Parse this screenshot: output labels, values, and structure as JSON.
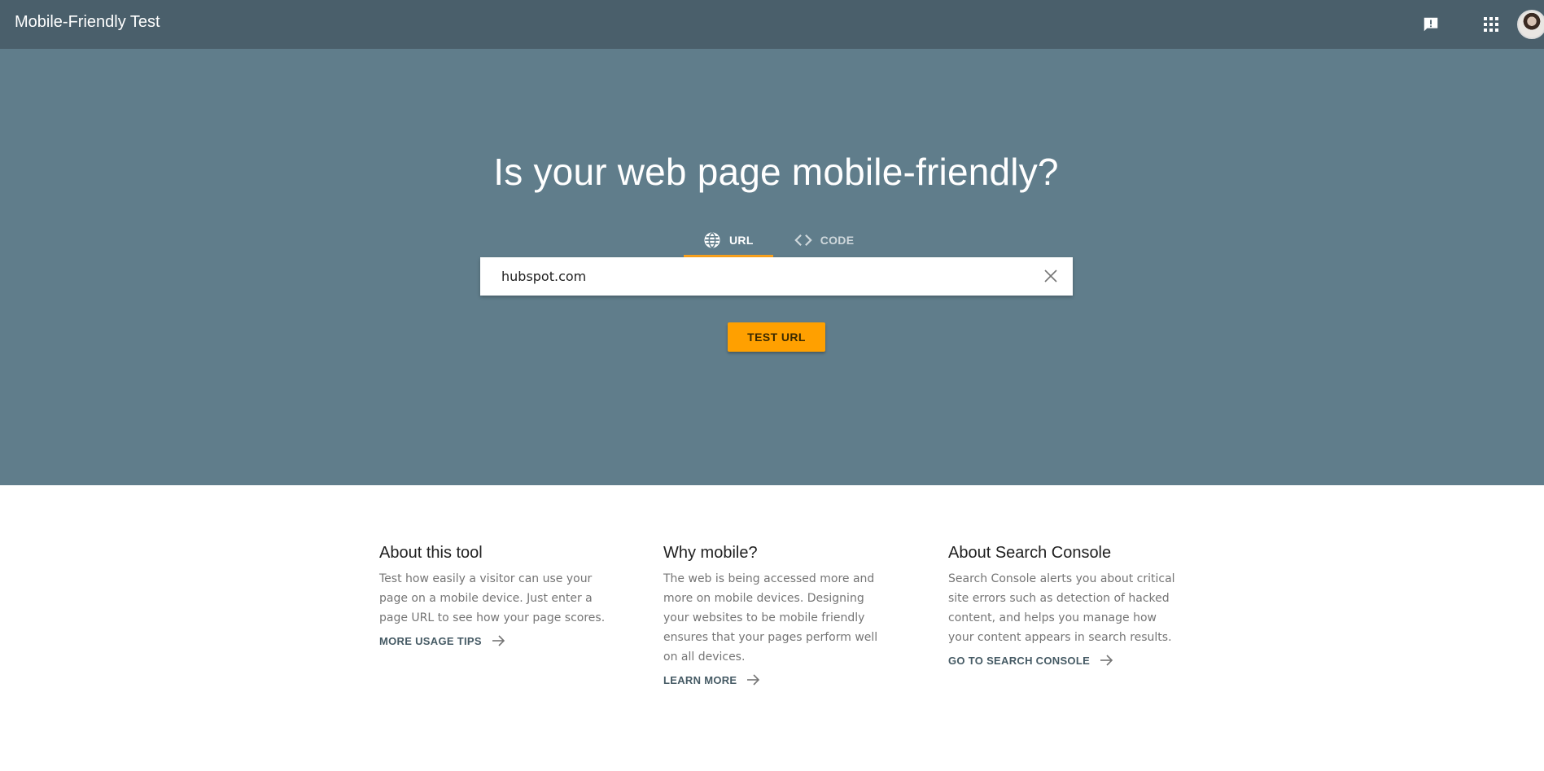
{
  "header": {
    "app_title": "Mobile-Friendly Test",
    "feedback_icon": "feedback-icon",
    "apps_icon": "apps-grid-icon",
    "avatar_icon": "user-avatar"
  },
  "hero": {
    "title": "Is your web page mobile-friendly?",
    "tabs": [
      {
        "label": "URL",
        "icon": "globe-icon",
        "active": true
      },
      {
        "label": "CODE",
        "icon": "code-icon",
        "active": false
      }
    ],
    "url_input": {
      "value": "hubspot.com",
      "placeholder": ""
    },
    "test_button_label": "TEST URL"
  },
  "info": [
    {
      "heading": "About this tool",
      "body": "Test how easily a visitor can use your page on a mobile device. Just enter a page URL to see how your page scores.",
      "link": "MORE USAGE TIPS"
    },
    {
      "heading": "Why mobile?",
      "body": "The web is being accessed more and more on mobile devices. Designing your websites to be mobile friendly ensures that your pages perform well on all devices.",
      "link": "LEARN MORE"
    },
    {
      "heading": "About Search Console",
      "body": "Search Console alerts you about critical site errors such as detection of hacked content, and helps you manage how your content appears in search results.",
      "link": "GO TO SEARCH CONSOLE"
    }
  ],
  "colors": {
    "header_bg": "#4a5f6b",
    "hero_bg": "#607d8b",
    "accent": "#ffa000",
    "tab_underline": "#f9a11c"
  }
}
